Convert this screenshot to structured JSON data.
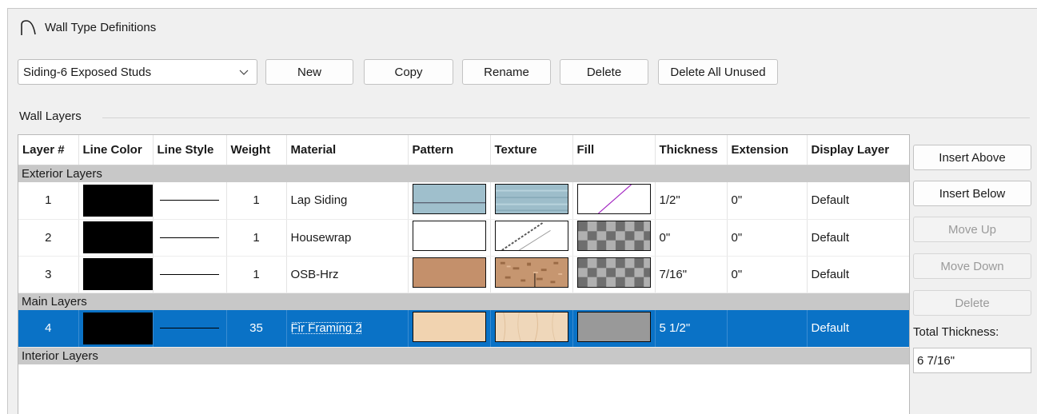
{
  "window": {
    "title": "Wall Type Definitions",
    "icon": "arch-icon"
  },
  "toolbar": {
    "selected_wall_type": "Siding-6 Exposed Studs",
    "new_label": "New",
    "copy_label": "Copy",
    "rename_label": "Rename",
    "delete_label": "Delete",
    "delete_all_unused_label": "Delete All Unused"
  },
  "wall_layers": {
    "group_label": "Wall Layers",
    "columns": [
      "Layer #",
      "Line Color",
      "Line Style",
      "Weight",
      "Material",
      "Pattern",
      "Texture",
      "Fill",
      "Thickness",
      "Extension",
      "Display Layer"
    ],
    "sections": {
      "exterior": "Exterior Layers",
      "main": "Main Layers",
      "interior": "Interior Layers"
    },
    "rows": [
      {
        "layer": "1",
        "line_color": "#000000",
        "weight": "1",
        "material": "Lap Siding",
        "pattern": "lap-siding-pattern",
        "texture": "lap-siding-texture",
        "fill": "diagonal-line-fill",
        "thickness": "1/2\"",
        "extension": "0\"",
        "display_layer": "Default"
      },
      {
        "layer": "2",
        "line_color": "#000000",
        "weight": "1",
        "material": "Housewrap",
        "pattern": "blank-pattern",
        "texture": "housewrap-texture",
        "fill": "checker-fill",
        "thickness": "0\"",
        "extension": "0\"",
        "display_layer": "Default"
      },
      {
        "layer": "3",
        "line_color": "#000000",
        "weight": "1",
        "material": "OSB-Hrz",
        "pattern": "osb-pattern",
        "texture": "osb-texture",
        "fill": "checker-fill",
        "thickness": "7/16\"",
        "extension": "0\"",
        "display_layer": "Default"
      },
      {
        "layer": "4",
        "line_color": "#000000",
        "weight": "35",
        "material": "Fir Framing 2",
        "pattern": "fir-pattern",
        "texture": "fir-texture",
        "fill": "gray-fill",
        "thickness": "5 1/2\"",
        "extension": "",
        "display_layer": "Default"
      }
    ]
  },
  "side_buttons": {
    "insert_above": "Insert Above",
    "insert_below": "Insert Below",
    "move_up": "Move Up",
    "move_down": "Move Down",
    "delete": "Delete"
  },
  "total": {
    "label": "Total Thickness:",
    "value": "6 7/16\""
  },
  "colors": {
    "dialog_bg": "#f0f0f0",
    "section_bg": "#c8c8c8",
    "selection": "#0a72c6",
    "lap_siding": "#9fbfcc",
    "osb": "#c4906b",
    "fir": "#f1d3b0",
    "fill_gray": "#999999"
  }
}
